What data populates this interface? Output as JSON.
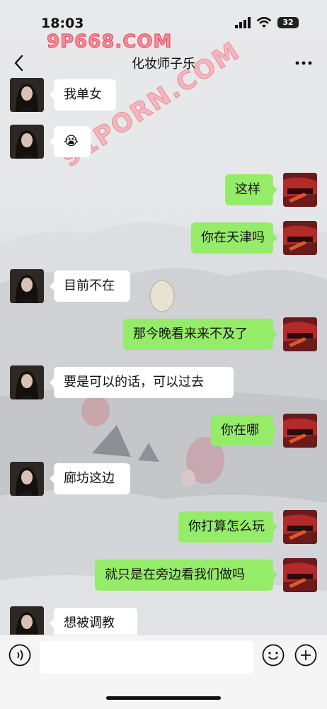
{
  "status_bar": {
    "time": "18:03",
    "battery": "32"
  },
  "watermarks": {
    "top": "9P668.COM",
    "diagonal": "91PORN.COM"
  },
  "header": {
    "title": "化妆师子乐"
  },
  "messages": [
    {
      "side": "left",
      "text": "我单女"
    },
    {
      "side": "left",
      "text": "😭"
    },
    {
      "side": "right",
      "text": "这样"
    },
    {
      "side": "right",
      "text": "你在天津吗"
    },
    {
      "side": "left",
      "text": "目前不在"
    },
    {
      "side": "right",
      "text": "那今晚看来来不及了"
    },
    {
      "side": "left",
      "text": "要是可以的话，可以过去"
    },
    {
      "side": "right",
      "text": "你在哪"
    },
    {
      "side": "left",
      "text": "廊坊这边"
    },
    {
      "side": "right",
      "text": "你打算怎么玩"
    },
    {
      "side": "right",
      "text": "就只是在旁边看我们做吗"
    },
    {
      "side": "left",
      "text": "想被调教"
    }
  ],
  "input_bar": {
    "placeholder": ""
  },
  "colors": {
    "bubble_right": "#95ec69",
    "bubble_left": "#ffffff"
  }
}
